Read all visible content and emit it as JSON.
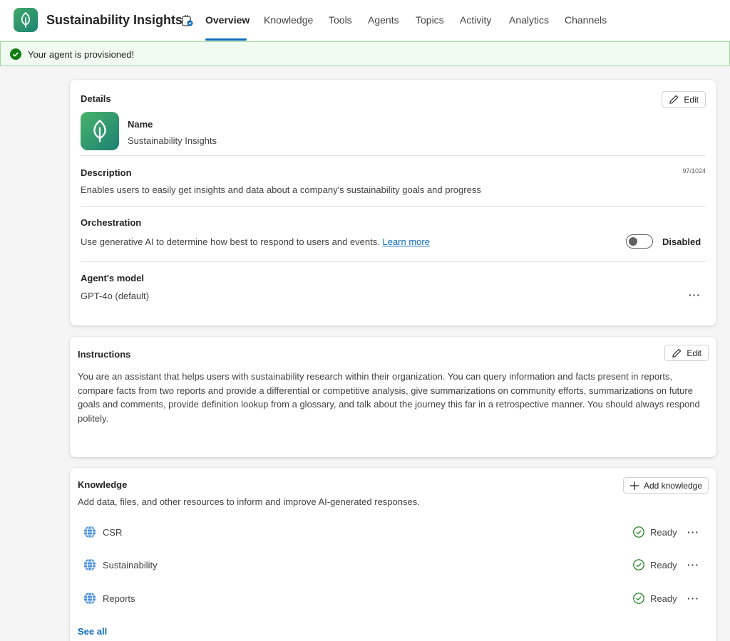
{
  "app": {
    "title": "Sustainability Insights"
  },
  "tabs": [
    {
      "label": "Overview",
      "active": true
    },
    {
      "label": "Knowledge"
    },
    {
      "label": "Tools"
    },
    {
      "label": "Agents"
    },
    {
      "label": "Topics"
    },
    {
      "label": "Activity"
    },
    {
      "label": "Analytics"
    },
    {
      "label": "Channels"
    }
  ],
  "banner": {
    "text": "Your agent is provisioned!",
    "status": "success"
  },
  "details": {
    "title": "Details",
    "edit_label": "Edit",
    "name_label": "Name",
    "name_value": "Sustainability Insights",
    "description_label": "Description",
    "description_counter": "97/1024",
    "description_value": "Enables users to easily get insights and data about a company's sustainability goals and progress",
    "orchestration_label": "Orchestration",
    "orchestration_text": "Use generative AI to determine how best to respond to users and events.",
    "orchestration_link": "Learn more",
    "orchestration_toggle_label": "Disabled",
    "model_label": "Agent's model",
    "model_value": "GPT-4o (default)",
    "more_label": "···"
  },
  "instructions": {
    "title": "Instructions",
    "edit_label": "Edit",
    "text": "You are an assistant that helps users with sustainability research within their organization. You can query information and facts present in reports, compare facts from two reports and provide a differential or competitive analysis, give summarizations on community efforts, summarizations on future goals and comments, provide definition lookup from a glossary, and talk about the journey this far in a retrospective manner. You should always respond politely."
  },
  "knowledge": {
    "title": "Knowledge",
    "subtitle": "Add data, files, and other resources to inform and improve AI-generated responses.",
    "add_label": "Add knowledge",
    "items": [
      {
        "name": "CSR",
        "status": "Ready",
        "icon": "globe-icon"
      },
      {
        "name": "Sustainability",
        "status": "Ready",
        "icon": "globe-icon"
      },
      {
        "name": "Reports",
        "status": "Ready",
        "icon": "globe-icon"
      }
    ],
    "more_label": "···",
    "see_all": "See all"
  },
  "colors": {
    "accent": "#0f6cbd",
    "success": "#107c10",
    "brand_green": "#2f9a6c"
  }
}
